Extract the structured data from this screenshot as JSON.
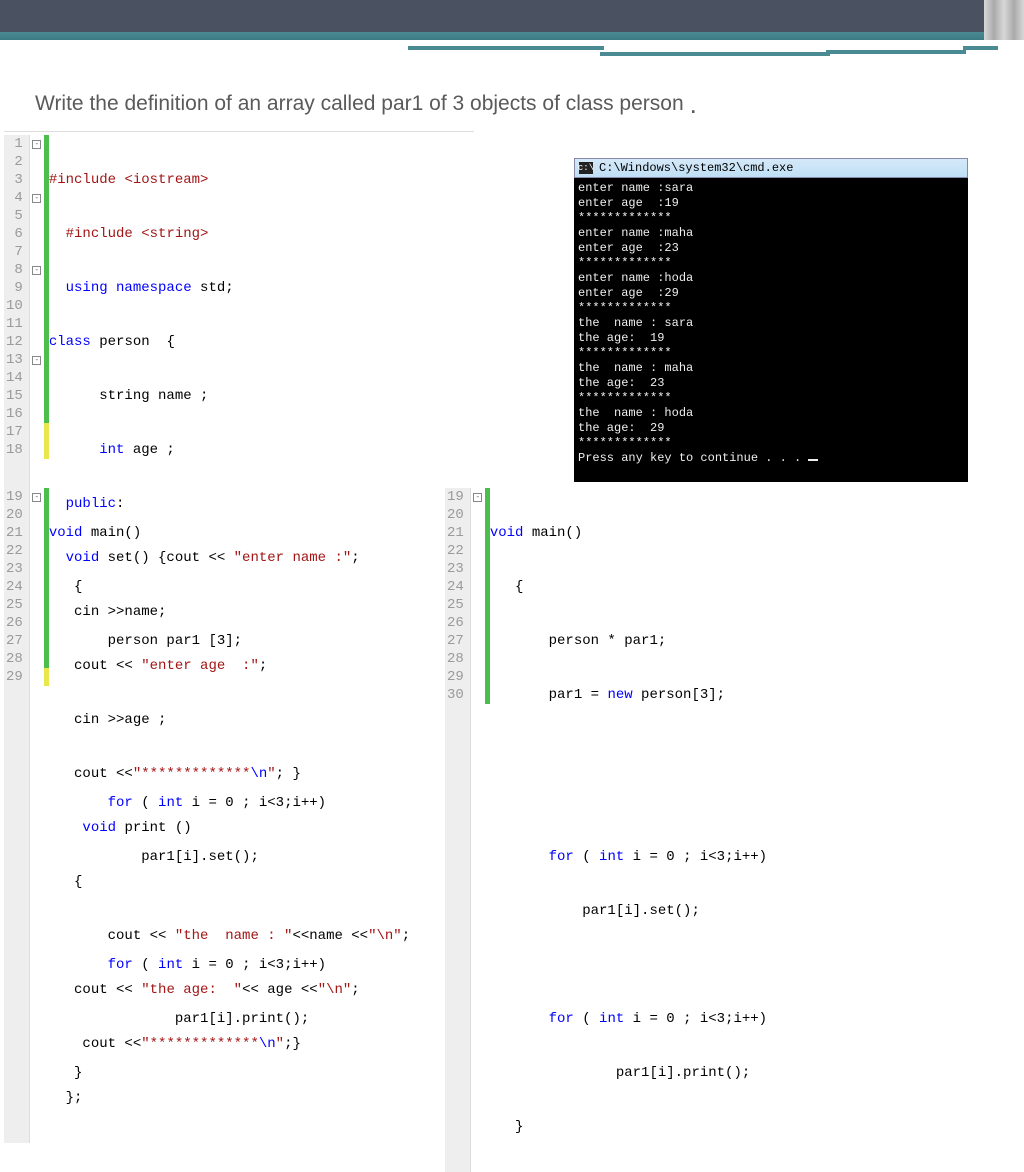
{
  "title": "Write the definition of an array called par1 of 3 objects of class person",
  "top": {
    "num": [
      "1",
      "2",
      "3",
      "4",
      "5",
      "6",
      "7",
      "8",
      "9",
      "10",
      "11",
      "12",
      "13",
      "14",
      "15",
      "16",
      "17",
      "18"
    ],
    "l1a": "#include ",
    "l1b": "<iostream>",
    "l2a": "  #include ",
    "l2b": "<string>",
    "l3a": "  using namespace ",
    "l3b": "std;",
    "l4a": "class ",
    "l4b": "person  {",
    "l5": "      string name ;",
    "l6a": "      int ",
    "l6b": "age ;",
    "l7a": "  public",
    "l8a": "  void ",
    "l8b": "set() {cout << ",
    "l8c": "\"enter name :\"",
    "l8d": ";",
    "l9": "   cin >>name;",
    "l10a": "   cout << ",
    "l10b": "\"enter age  :\"",
    "l10c": ";",
    "l11": "   cin >>age ;",
    "l12a": "   cout <<",
    "l12b": "\"*************",
    "l12c": "\\n",
    "l12d": "\"",
    "l12e": "; }",
    "l13a": "    void ",
    "l13b": "print ()",
    "l14": "   {",
    "l15a": "       cout << ",
    "l15b": "\"the  name : \"",
    "l15c": "<<name <<",
    "l15d": "\"\\n\"",
    "l15e": ";",
    "l16a": "   cout << ",
    "l16b": "\"the age:  \"",
    "l16c": "<< age <<",
    "l16d": "\"\\n\"",
    "l16e": ";",
    "l17a": "    cout <<",
    "l17b": "\"*************",
    "l17c": "\\n",
    "l17d": "\"",
    "l17e": ";}",
    "l18": "  };"
  },
  "bl": {
    "num": [
      "19",
      "20",
      "21",
      "22",
      "23",
      "24",
      "25",
      "26",
      "27",
      "28",
      "29"
    ],
    "l1a": "void ",
    "l1b": "main()",
    "l2": "   {",
    "l3": "       person par1 [3];",
    "l4": "",
    "l5": "",
    "l6a": "       for ",
    "l6b": "( ",
    "l6c": "int ",
    "l6d": "i = 0 ; i<3;i++)",
    "l7": "           par1[i].set();",
    "l8": "",
    "l9a": "       for ",
    "l9b": "( ",
    "l9c": "int ",
    "l9d": "i = 0 ; i<3;i++)",
    "l10": "               par1[i].print();",
    "l11": "   }"
  },
  "br": {
    "num": [
      "19",
      "20",
      "21",
      "22",
      "23",
      "24",
      "25",
      "26",
      "27",
      "28",
      "29",
      "30"
    ],
    "l1a": "void ",
    "l1b": "main()",
    "l2": "   {",
    "l3": "       person * par1;",
    "l4a": "       par1 = ",
    "l4b": "new ",
    "l4c": "person[3];",
    "l5": "",
    "l6": "",
    "l7a": "       for ",
    "l7b": "( ",
    "l7c": "int ",
    "l7d": "i = 0 ; i<3;i++)",
    "l8": "           par1[i].set();",
    "l9": "",
    "l10a": "       for ",
    "l10b": "( ",
    "l10c": "int ",
    "l10d": "i = 0 ; i<3;i++)",
    "l11": "               par1[i].print();",
    "l12": "   }"
  },
  "cmd": {
    "title": "C:\\Windows\\system32\\cmd.exe",
    "body": "enter name :sara\nenter age  :19\n*************\nenter name :maha\nenter age  :23\n*************\nenter name :hoda\nenter age  :29\n*************\nthe  name : sara\nthe age:  19\n*************\nthe  name : maha\nthe age:  23\n*************\nthe  name : hoda\nthe age:  29\n*************\nPress any key to continue . . . "
  }
}
